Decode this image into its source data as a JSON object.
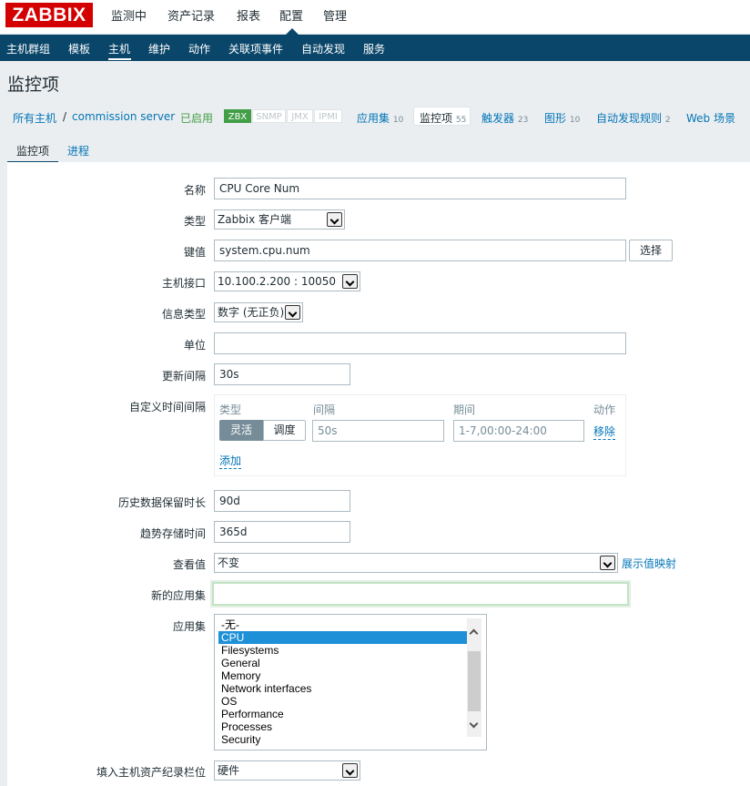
{
  "brand": {
    "logo_text": "ZABBIX",
    "logo_color": "#d40000"
  },
  "top_menu": [
    "监测中",
    "资产记录",
    "报表",
    "配置",
    "管理"
  ],
  "top_menu_active": "配置",
  "sub_menu": [
    "主机群组",
    "模板",
    "主机",
    "维护",
    "动作",
    "关联项事件",
    "自动发现",
    "服务"
  ],
  "sub_menu_active": "主机",
  "page_title": "监控项",
  "breadcrumb": {
    "all_hosts": "所有主机",
    "separator": "/",
    "host": "commission server",
    "status": "已启用",
    "protocols": [
      "ZBX",
      "SNMP",
      "JMX",
      "IPMI"
    ],
    "links": [
      {
        "label": "应用集",
        "count": "10"
      },
      {
        "label": "监控项",
        "count": "55"
      },
      {
        "label": "触发器",
        "count": "23"
      },
      {
        "label": "图形",
        "count": "10"
      },
      {
        "label": "自动发现规则",
        "count": "2"
      },
      {
        "label": "Web 场景",
        "count": ""
      }
    ]
  },
  "tabs": [
    "监控项",
    "进程"
  ],
  "form": {
    "name_label": "名称",
    "name_value": "CPU Core Num",
    "type_label": "类型",
    "type_value": "Zabbix 客户端",
    "key_label": "键值",
    "key_value": "system.cpu.num",
    "key_select_button": "选择",
    "interface_label": "主机接口",
    "interface_value": "10.100.2.200 : 10050",
    "info_type_label": "信息类型",
    "info_type_value": "数字 (无正负)",
    "units_label": "单位",
    "units_value": "",
    "update_interval_label": "更新间隔",
    "update_interval_value": "30s",
    "custom_intervals_label": "自定义时间间隔",
    "custom_intervals": {
      "col_type": "类型",
      "col_interval": "间隔",
      "col_period": "期间",
      "col_action": "动作",
      "toggle_flexible": "灵活",
      "toggle_scheduling": "调度",
      "interval_value": "50s",
      "period_value": "1-7,00:00-24:00",
      "remove_link": "移除",
      "add_link": "添加"
    },
    "history_label": "历史数据保留时长",
    "history_value": "90d",
    "trends_label": "趋势存储时间",
    "trends_value": "365d",
    "valuemap_label": "查看值",
    "valuemap_value": "不变",
    "valuemap_link": "展示值映射",
    "new_app_label": "新的应用集",
    "new_app_value": "",
    "apps_label": "应用集",
    "apps_options": [
      "-无-",
      "CPU",
      "Filesystems",
      "General",
      "Memory",
      "Network interfaces",
      "OS",
      "Performance",
      "Processes",
      "Security"
    ],
    "apps_selected": "CPU",
    "inventory_label": "填入主机资产纪录栏位",
    "inventory_value": "硬件"
  }
}
